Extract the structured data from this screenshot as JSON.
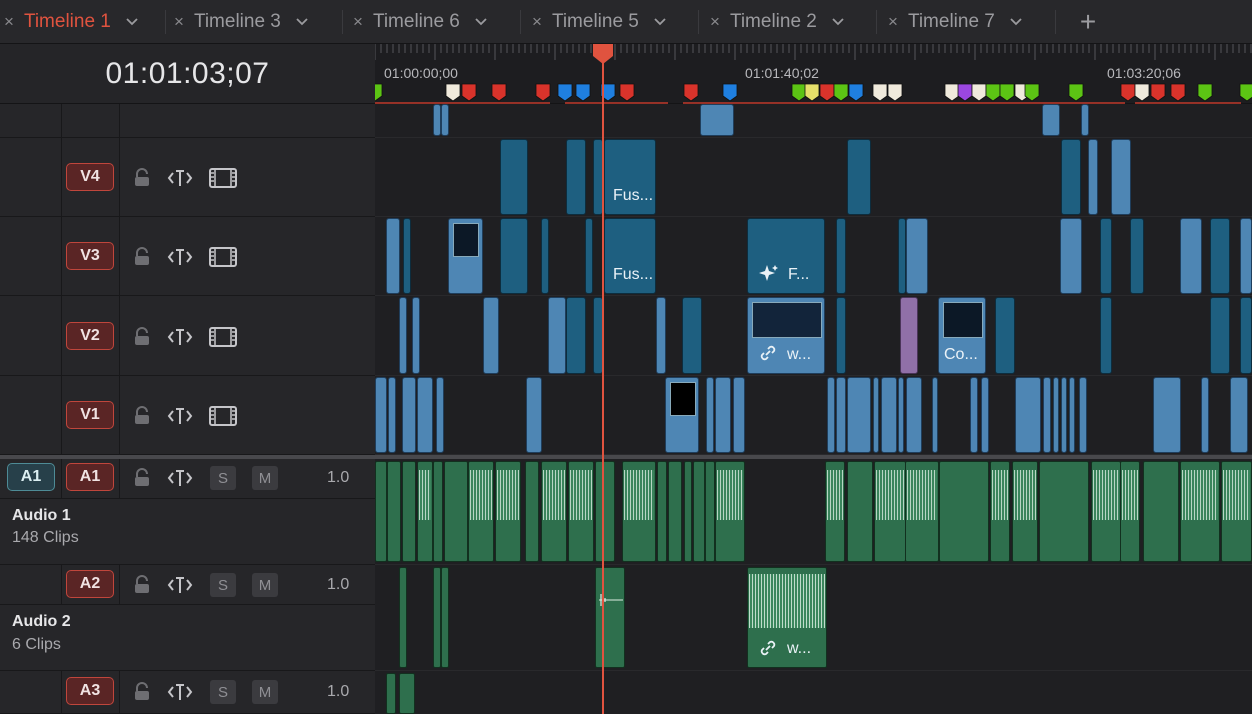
{
  "tabs": [
    {
      "label": "Timeline 1",
      "active": true
    },
    {
      "label": "Timeline 3",
      "active": false
    },
    {
      "label": "Timeline 6",
      "active": false
    },
    {
      "label": "Timeline 5",
      "active": false
    },
    {
      "label": "Timeline 2",
      "active": false
    },
    {
      "label": "Timeline 7",
      "active": false
    }
  ],
  "add_tab_glyph": "+",
  "close_glyph": "×",
  "timecode": "01:01:03;07",
  "ruler": {
    "labels": [
      "01:00:00;00",
      "01:01:40;02",
      "01:03:20;06"
    ]
  },
  "tracks": {
    "v4": {
      "label": "V4"
    },
    "v3": {
      "label": "V3"
    },
    "v2": {
      "label": "V2"
    },
    "v1": {
      "label": "V1"
    },
    "a1": {
      "label": "A1",
      "dest_label": "A1",
      "name": "Audio 1",
      "clips": "148 Clips",
      "volume": "1.0",
      "solo": "S",
      "mute": "M"
    },
    "a2": {
      "label": "A2",
      "name": "Audio 2",
      "clips": "6 Clips",
      "volume": "1.0",
      "solo": "S",
      "mute": "M"
    },
    "a3": {
      "label": "A3",
      "volume": "1.0",
      "solo": "S",
      "mute": "M"
    }
  },
  "clips": {
    "v4_fusion": "Fus...",
    "v3_fusion": "Fus...",
    "v3_effect": "F...",
    "v2_linked": "w...",
    "v2_comp": "Co...",
    "a2_linked": "w..."
  },
  "colors": {
    "accent": "#e0533f",
    "video_clip": "#1e5f80",
    "video_clip_light": "#4e86b4",
    "audio_clip": "#2e6f4d",
    "track_badge": "#5a2525"
  },
  "icons": {
    "lock": "lock-icon",
    "auto_select": "auto-select-icon",
    "film": "film-strip-icon",
    "chevron": "chevron-down-icon",
    "link": "link-icon",
    "sparkle": "sparkle-icon"
  }
}
